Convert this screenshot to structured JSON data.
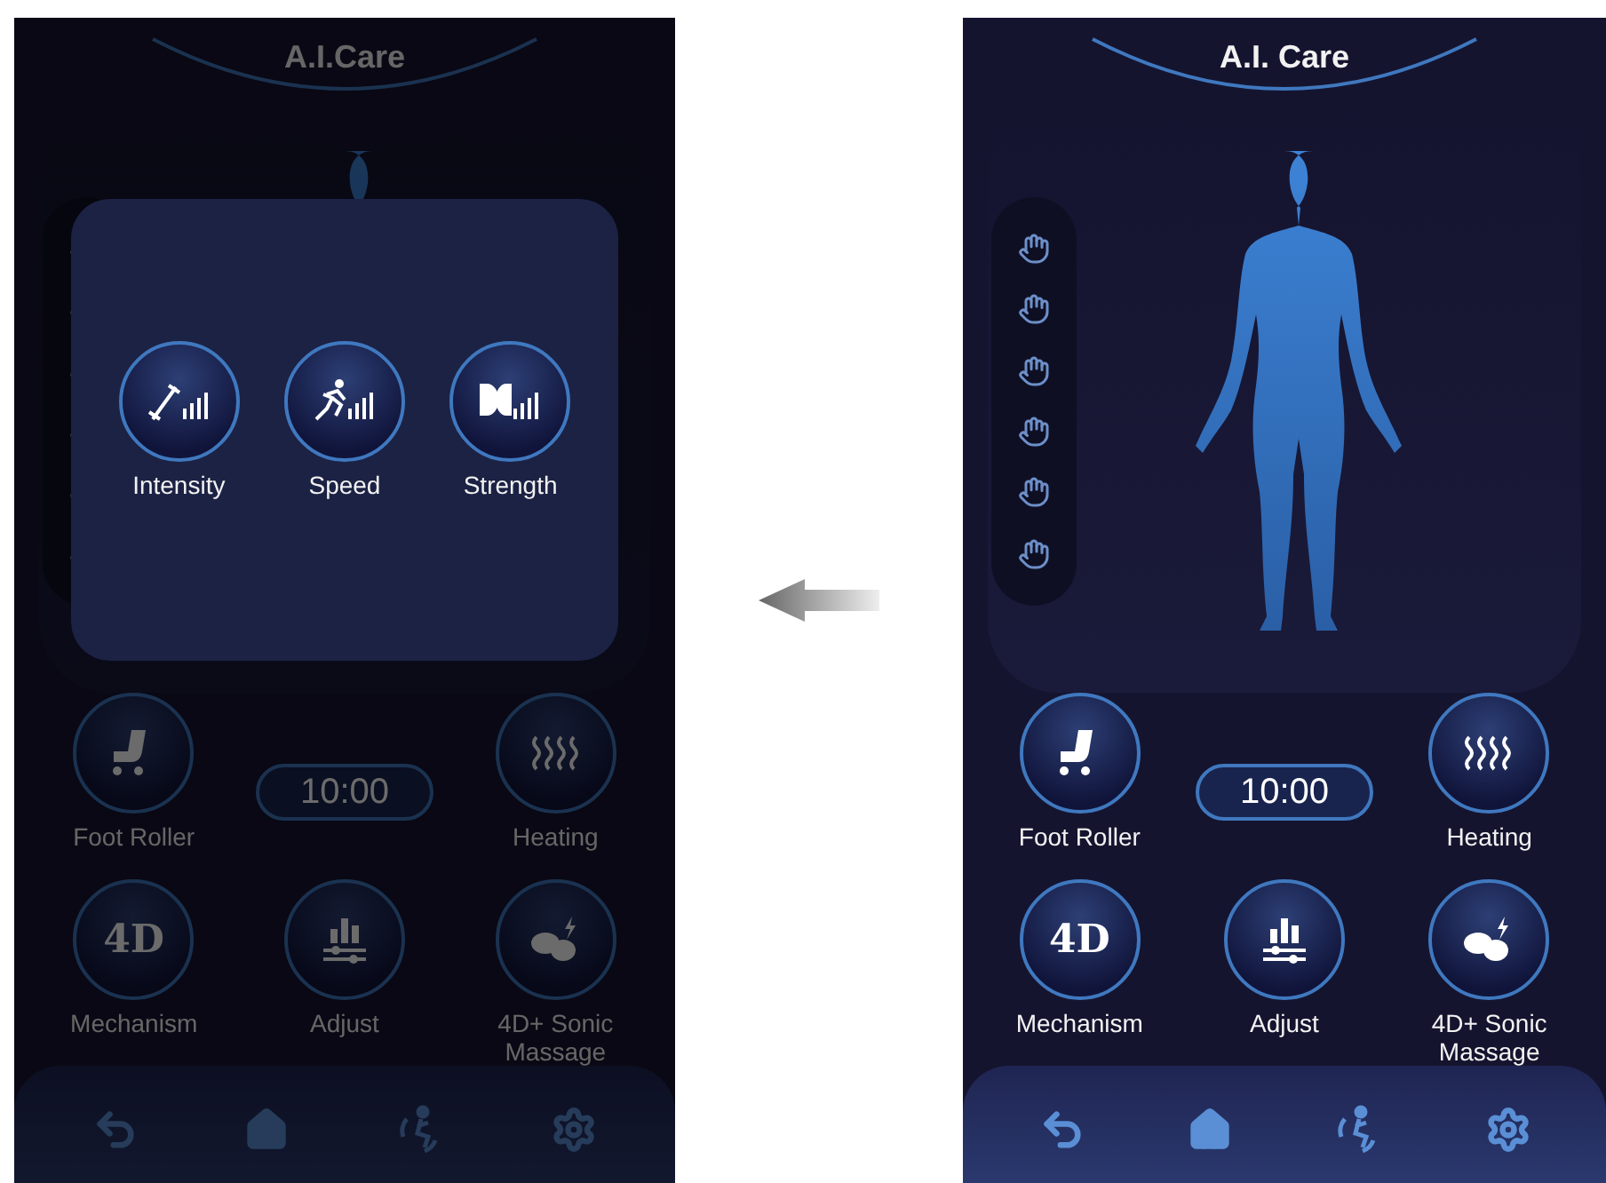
{
  "screens": [
    {
      "title": "A.I.Care",
      "dimmed": true,
      "popup": {
        "items": [
          {
            "kind": "intensity",
            "label": "Intensity"
          },
          {
            "kind": "speed",
            "label": "Speed"
          },
          {
            "kind": "strength",
            "label": "Strength"
          }
        ]
      },
      "timer": "10:00",
      "controls": [
        {
          "kind": "roller",
          "label": "Foot Roller"
        },
        {
          "kind": "heating",
          "label": "Heating"
        },
        {
          "kind": "mechanism",
          "label": "Mechanism",
          "icon_text": "4D"
        },
        {
          "kind": "adjust",
          "label": "Adjust"
        },
        {
          "kind": "sonic",
          "label": "4D+ Sonic Massage"
        }
      ]
    },
    {
      "title": "A.I. Care",
      "dimmed": false,
      "timer": "10:00",
      "controls": [
        {
          "kind": "roller",
          "label": "Foot Roller"
        },
        {
          "kind": "heating",
          "label": "Heating"
        },
        {
          "kind": "mechanism",
          "label": "Mechanism",
          "icon_text": "4D"
        },
        {
          "kind": "adjust",
          "label": "Adjust"
        },
        {
          "kind": "sonic",
          "label": "4D+ Sonic Massage"
        }
      ]
    }
  ]
}
